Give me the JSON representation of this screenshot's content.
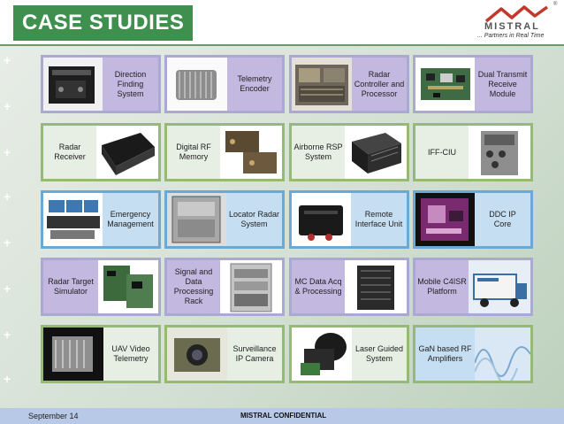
{
  "header": {
    "title": "CASE STUDIES"
  },
  "logo": {
    "name": "MISTRAL",
    "tagline": "... Partners in Real Time",
    "registered": "®"
  },
  "footer": {
    "date": "September 14",
    "confidential": "MISTRAL CONFIDENTIAL"
  },
  "cards": [
    {
      "label": "Direction\nFinding\nSystem",
      "image": "antenna-equipment-case"
    },
    {
      "label": "Telemetry\nEncoder",
      "image": "heat-sink-encoder"
    },
    {
      "label": "Radar\nController and\nProcessor",
      "image": "radar-controller-rack"
    },
    {
      "label": "Dual Transmit\nReceive\nModule",
      "image": "circuit-board"
    },
    {
      "label": "Radar\nReceiver",
      "image": "mistral-receiver-box"
    },
    {
      "label": "Digital RF\nMemory",
      "image": "drfm-units"
    },
    {
      "label": "Airborne RSP\nSystem",
      "image": "rsp-chassis"
    },
    {
      "label": "IFF-CIU",
      "image": "iff-chassis"
    },
    {
      "label": "Emergency\nManagement",
      "image": "control-console"
    },
    {
      "label": "Locator Radar\nSystem",
      "image": "radar-cabinet"
    },
    {
      "label": "Remote\nInterface Unit",
      "image": "black-interface-box"
    },
    {
      "label": "DDC IP\nCore",
      "image": "ddc-board"
    },
    {
      "label": "Radar Target\nSimulator",
      "image": "simulator-boards"
    },
    {
      "label": "Signal and\nData\nProcessing\nRack",
      "image": "processing-rack"
    },
    {
      "label": "MC Data Acq\n& Processing",
      "image": "data-acq-unit"
    },
    {
      "label": "Mobile C4ISR\nPlatform",
      "image": "c4isr-truck"
    },
    {
      "label": "UAV Video\nTelemetry",
      "image": "uav-module"
    },
    {
      "label": "Surveillance\nIP Camera",
      "image": "ptz-camera"
    },
    {
      "label": "Laser Guided\nSystem",
      "image": "laser-seeker"
    },
    {
      "label": "GaN based RF\nAmplifiers",
      "image": "rf-amplifier"
    }
  ]
}
